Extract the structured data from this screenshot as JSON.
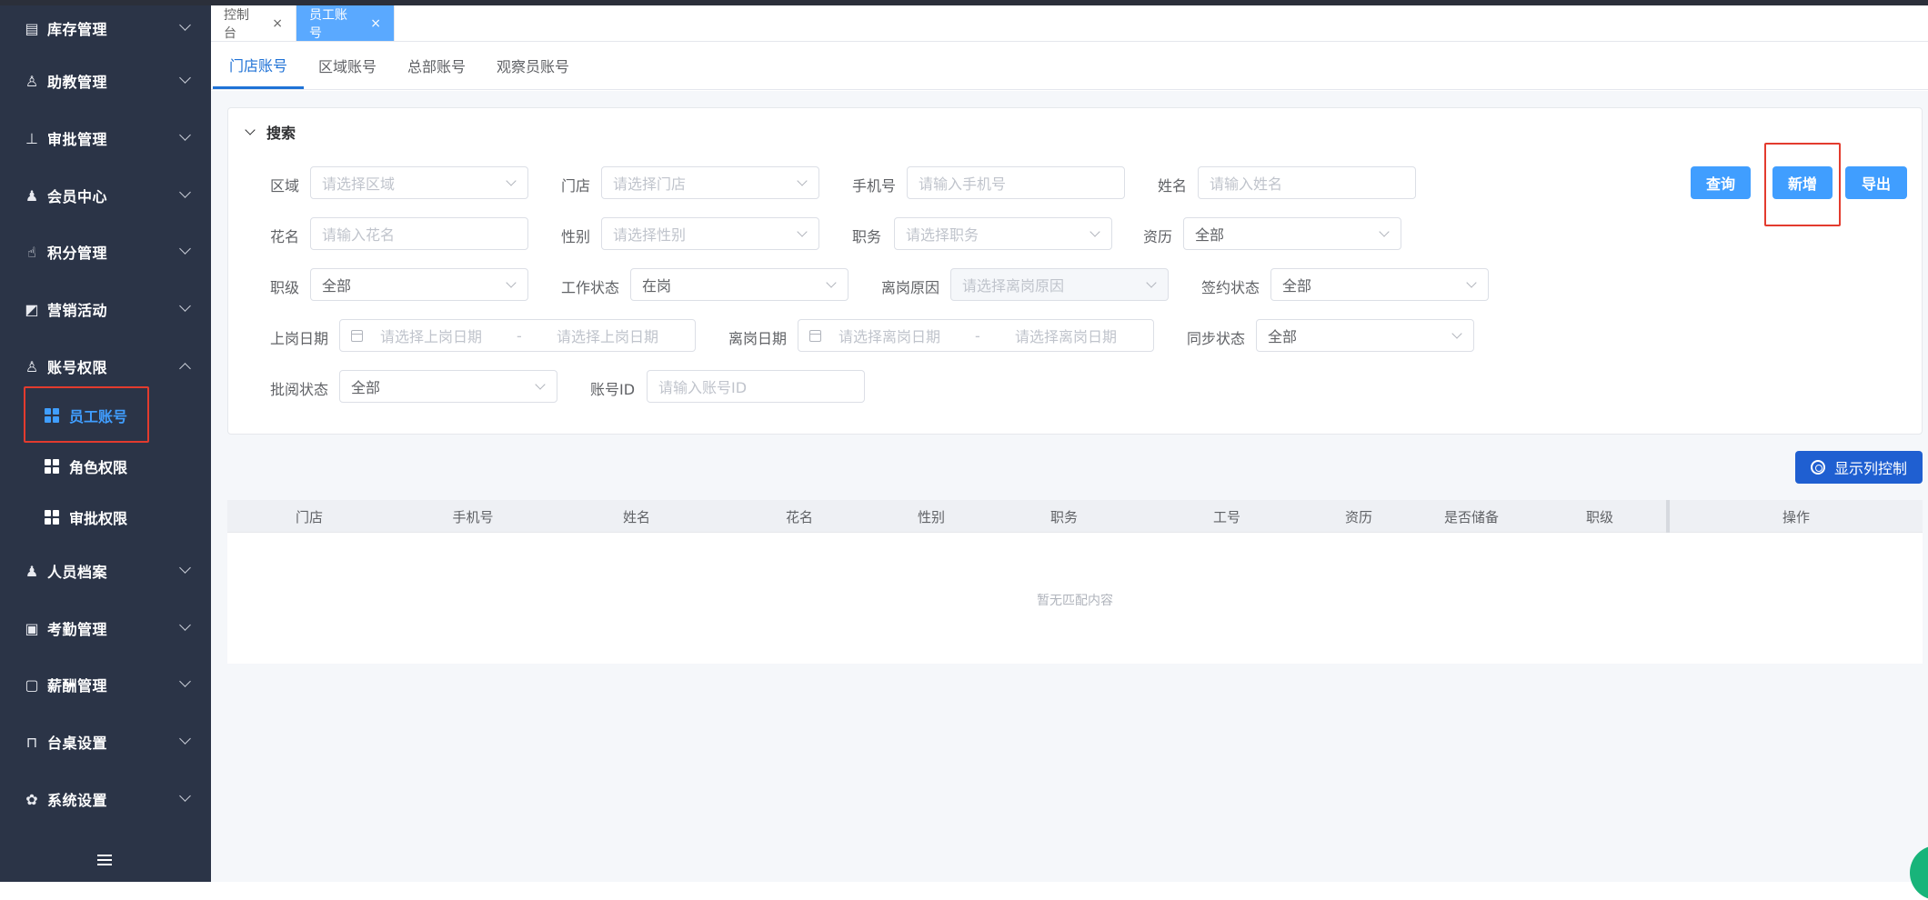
{
  "sidebar": {
    "menus": [
      {
        "label": "库存管理",
        "icon": "inventory-icon"
      },
      {
        "label": "助教管理",
        "icon": "person-icon"
      },
      {
        "label": "审批管理",
        "icon": "approve-icon"
      },
      {
        "label": "会员中心",
        "icon": "member-icon"
      },
      {
        "label": "积分管理",
        "icon": "points-icon"
      },
      {
        "label": "营销活动",
        "icon": "chart-icon"
      },
      {
        "label": "账号权限",
        "icon": "account-icon"
      },
      {
        "label": "人员档案",
        "icon": "profile-icon"
      },
      {
        "label": "考勤管理",
        "icon": "attendance-icon"
      },
      {
        "label": "薪酬管理",
        "icon": "salary-icon"
      },
      {
        "label": "台桌设置",
        "icon": "table-icon"
      },
      {
        "label": "系统设置",
        "icon": "gear-icon"
      }
    ],
    "submenus": [
      {
        "label": "员工账号",
        "active": true
      },
      {
        "label": "角色权限",
        "active": false
      },
      {
        "label": "审批权限",
        "active": false
      }
    ]
  },
  "tabs": [
    {
      "label": "控制台",
      "close": "×"
    },
    {
      "label": "员工账号",
      "close": "×"
    }
  ],
  "subtabs": [
    "门店账号",
    "区域账号",
    "总部账号",
    "观察员账号"
  ],
  "search": {
    "title": "搜索",
    "fields": {
      "region": {
        "label": "区域",
        "placeholder": "请选择区域"
      },
      "store": {
        "label": "门店",
        "placeholder": "请选择门店"
      },
      "phone": {
        "label": "手机号",
        "placeholder": "请输入手机号"
      },
      "name": {
        "label": "姓名",
        "placeholder": "请输入姓名"
      },
      "nickname": {
        "label": "花名",
        "placeholder": "请输入花名"
      },
      "gender": {
        "label": "性别",
        "placeholder": "请选择性别"
      },
      "position": {
        "label": "职务",
        "placeholder": "请选择职务"
      },
      "seniority": {
        "label": "资历",
        "value": "全部"
      },
      "rank": {
        "label": "职级",
        "value": "全部"
      },
      "work_status": {
        "label": "工作状态",
        "value": "在岗"
      },
      "leave_reason": {
        "label": "离岗原因",
        "placeholder": "请选择离岗原因"
      },
      "contract_status": {
        "label": "签约状态",
        "value": "全部"
      },
      "onboard_date": {
        "label": "上岗日期",
        "start": "请选择上岗日期",
        "sep": "-",
        "end": "请选择上岗日期"
      },
      "leave_date": {
        "label": "离岗日期",
        "start": "请选择离岗日期",
        "sep": "-",
        "end": "请选择离岗日期"
      },
      "sync_status": {
        "label": "同步状态",
        "value": "全部"
      },
      "review_status": {
        "label": "批阅状态",
        "value": "全部"
      },
      "account_id": {
        "label": "账号ID",
        "placeholder": "请输入账号ID"
      }
    },
    "buttons": {
      "query": "查询",
      "add": "新增",
      "export": "导出"
    }
  },
  "column_control": "显示列控制",
  "table": {
    "columns": [
      "门店",
      "手机号",
      "姓名",
      "花名",
      "性别",
      "职务",
      "工号",
      "资历",
      "是否储备",
      "职级",
      "操作"
    ],
    "empty_text": "暂无匹配内容"
  },
  "colors": {
    "sidebar_bg": "#2b3447",
    "primary": "#409eff",
    "highlight": "#e33b2e"
  }
}
